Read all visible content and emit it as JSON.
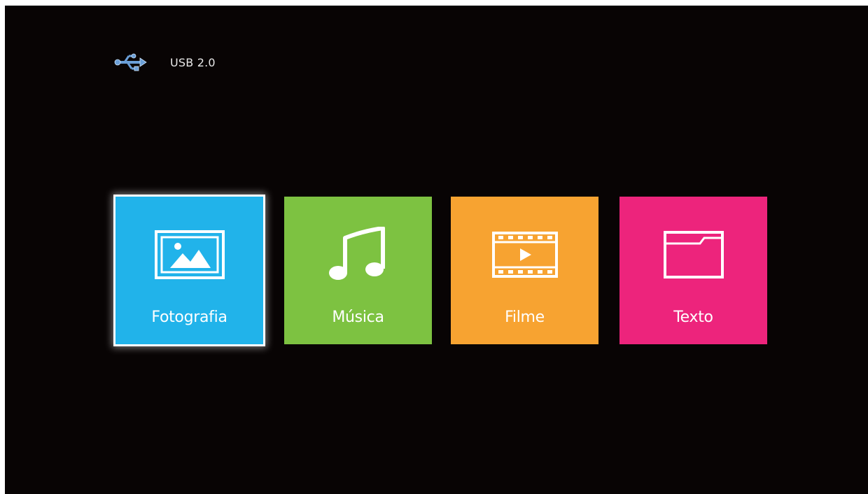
{
  "header": {
    "icon": "usb-icon",
    "source_label": "USB 2.0"
  },
  "menu": {
    "selected_index": 0,
    "tiles": [
      {
        "label": "Fotografia",
        "icon": "photo-icon",
        "color": "#21b3ea"
      },
      {
        "label": "Música",
        "icon": "music-note-icon",
        "color": "#7dc241"
      },
      {
        "label": "Filme",
        "icon": "film-icon",
        "color": "#f7a331"
      },
      {
        "label": "Texto",
        "icon": "folder-icon",
        "color": "#ed247c"
      }
    ]
  },
  "colors": {
    "background": "#080404",
    "text": "#ffffff",
    "selection_border": "#ffffff"
  }
}
